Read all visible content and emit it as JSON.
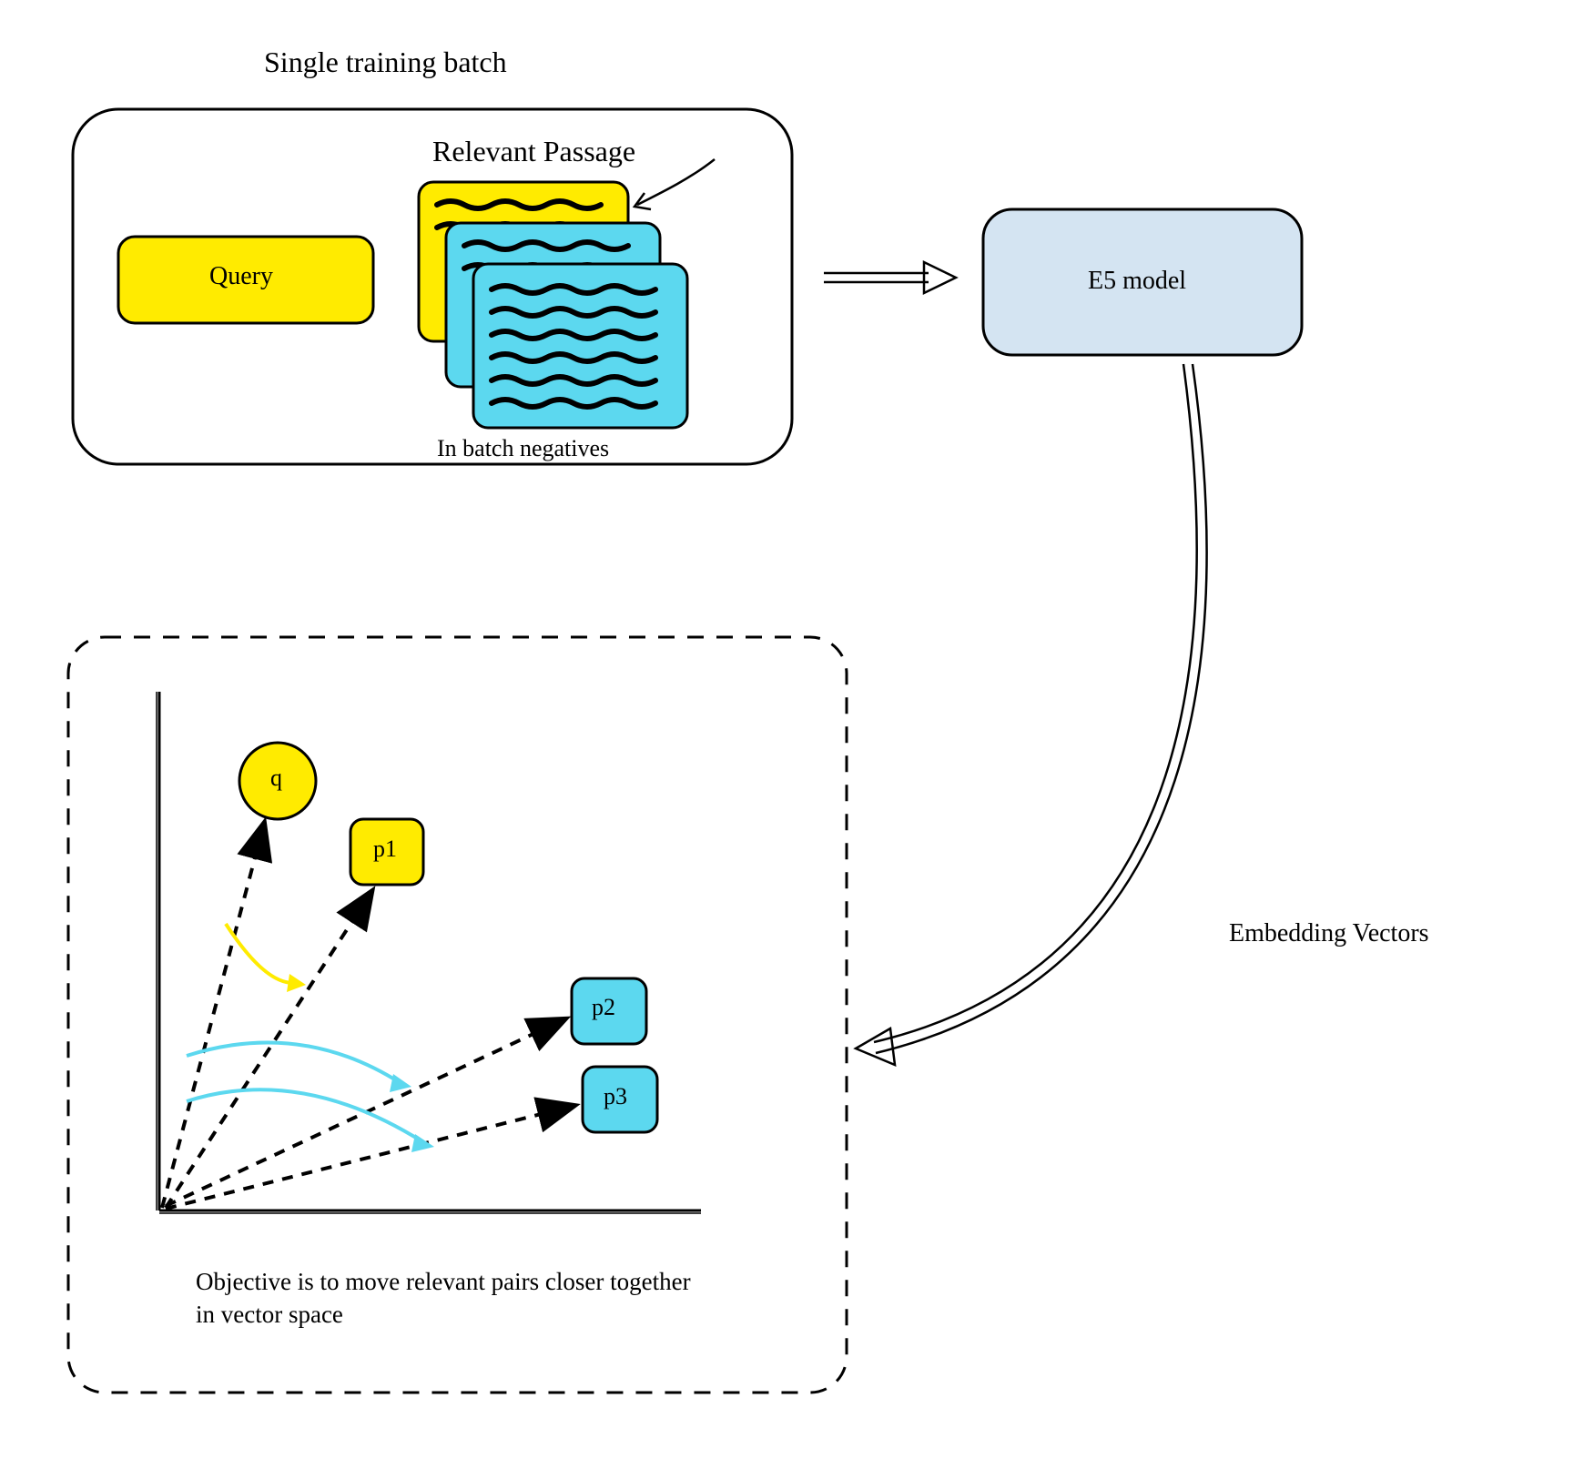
{
  "diagram": {
    "title": "Single training batch",
    "batch": {
      "query_label": "Query",
      "relevant_passage_label": "Relevant Passage",
      "negatives_label": "In batch negatives"
    },
    "model": {
      "label": "E5 model"
    },
    "flow": {
      "arrow_label": "Embedding Vectors"
    },
    "vectorspace": {
      "nodes": {
        "q": "q",
        "p1": "p1",
        "p2": "p2",
        "p3": "p3"
      },
      "objective": "Objective is to move relevant pairs closer together in vector space"
    },
    "colors": {
      "yellow": "#ffeb00",
      "cyan": "#5cd8ef",
      "lightblue": "#d4e4f2",
      "black": "#000000"
    }
  }
}
